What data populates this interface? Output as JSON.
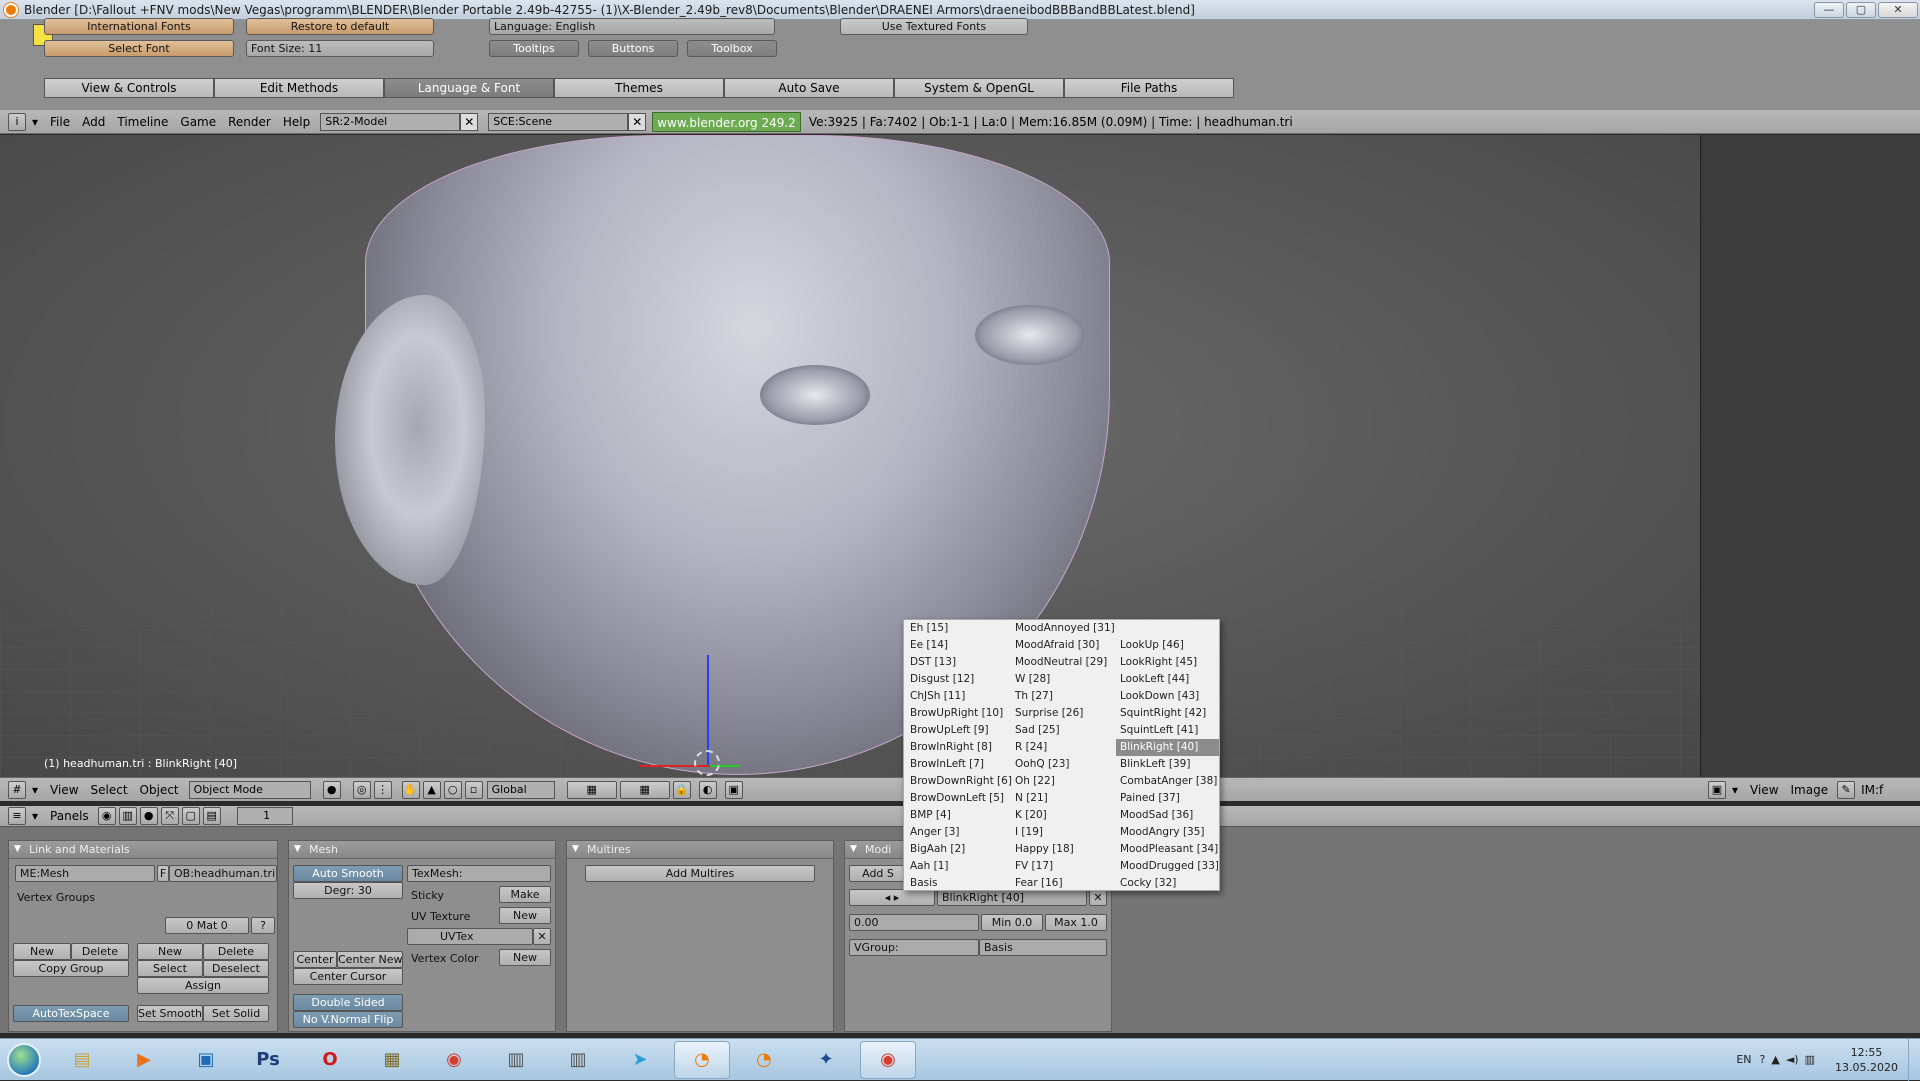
{
  "window": {
    "title": "Blender [D:\\Fallout +FNV mods\\New Vegas\\programm\\BLENDER\\Blender Portable 2.49b-42755- (1)\\X-Blender_2.49b_rev8\\Documents\\Blender\\DRAENEI Armors\\draeneibodBBBandBBLatest.blend]",
    "minimize": "—",
    "maximize": "▢",
    "close": "✕"
  },
  "prefs": {
    "international_fonts": "International Fonts",
    "select_font": "Select Font",
    "restore_default": "Restore to default",
    "font_size": "Font Size:  11",
    "language": "Language:  English",
    "use_textured_fonts": "Use Textured Fonts",
    "tooltips": "Tooltips",
    "buttons": "Buttons",
    "toolbox": "Toolbox",
    "tabs": [
      "View & Controls",
      "Edit Methods",
      "Language & Font",
      "Themes",
      "Auto Save",
      "System & OpenGL",
      "File Paths"
    ]
  },
  "menubar": {
    "items": [
      "File",
      "Add",
      "Timeline",
      "Game",
      "Render",
      "Help"
    ],
    "screen": "SR:2-Model",
    "scene": "SCE:Scene",
    "url": "www.blender.org 249.2",
    "stats": "Ve:3925 | Fa:7402 | Ob:1-1 | La:0  | Mem:16.85M (0.09M)  | Time:  | headhuman.tri"
  },
  "viewport": {
    "object_label": "(1) headhuman.tri : BlinkRight [40]"
  },
  "view3d_header": {
    "menus": [
      "View",
      "Select",
      "Object"
    ],
    "mode": "Object Mode",
    "orientation": "Global"
  },
  "image_header": {
    "menus": [
      "View",
      "Image"
    ],
    "im_field": "IM:f"
  },
  "buttons_header": {
    "panels": "Panels",
    "frame": "1"
  },
  "link_materials": {
    "title": "Link and Materials",
    "mesh": "ME:Mesh",
    "f": "F",
    "object": "OB:headhuman.tri",
    "vertex_groups": "Vertex Groups",
    "mat": "0 Mat 0",
    "q": "?",
    "new": "New",
    "delete": "Delete",
    "copy_group": "Copy Group",
    "new2": "New",
    "delete2": "Delete",
    "select": "Select",
    "deselect": "Deselect",
    "assign": "Assign",
    "autotexspace": "AutoTexSpace",
    "set_smooth": "Set Smooth",
    "set_solid": "Set Solid"
  },
  "mesh": {
    "title": "Mesh",
    "auto_smooth": "Auto Smooth",
    "degr": "Degr: 30",
    "texmesh": "TexMesh:",
    "sticky": "Sticky",
    "make": "Make",
    "uv_texture": "UV Texture",
    "new_uv": "New",
    "uvtex": "UVTex",
    "vertex_color": "Vertex Color",
    "new_vc": "New",
    "center": "Center",
    "center_new": "Center New",
    "center_cursor": "Center Cursor",
    "double_sided": "Double Sided",
    "no_vnormal_flip": "No V.Normal Flip"
  },
  "multires": {
    "title": "Multires",
    "add": "Add Multires"
  },
  "shapes": {
    "title": "Modi",
    "add": "Add S",
    "current": "BlinkRight [40]",
    "value": "0.00",
    "min": "Min 0.0",
    "max": "Max 1.0",
    "vgroup_label": "VGroup:",
    "vgroup": "Basis"
  },
  "shape_popup": {
    "col1": [
      "Eh [15]",
      "Ee [14]",
      "DST [13]",
      "Disgust [12]",
      "ChJSh [11]",
      "BrowUpRight [10]",
      "BrowUpLeft [9]",
      "BrowInRight [8]",
      "BrowInLeft [7]",
      "BrowDownRight [6]",
      "BrowDownLeft [5]",
      "BMP [4]",
      "Anger [3]",
      "BigAah [2]",
      "Aah [1]",
      "Basis"
    ],
    "col2": [
      "MoodAnnoyed [31]",
      "MoodAfraid [30]",
      "MoodNeutral [29]",
      "W [28]",
      "Th [27]",
      "Surprise [26]",
      "Sad [25]",
      "R [24]",
      "OohQ [23]",
      "Oh [22]",
      "N [21]",
      "K [20]",
      "I [19]",
      "Happy [18]",
      "FV [17]",
      "Fear [16]"
    ],
    "col3": [
      "",
      "LookUp [46]",
      "LookRight [45]",
      "LookLeft [44]",
      "LookDown [43]",
      "SquintRight [42]",
      "SquintLeft [41]",
      "BlinkRight [40]",
      "BlinkLeft [39]",
      "CombatAnger [38]",
      "Pained [37]",
      "MoodSad [36]",
      "MoodAngry [35]",
      "MoodPleasant [34]",
      "MoodDrugged [33]",
      "Cocky [32]"
    ],
    "highlighted": "BlinkRight [40]"
  },
  "taskbar": {
    "apps": [
      "Explorer",
      "Media",
      "Files",
      "Ps",
      "Opera",
      "Tool",
      "Chrome",
      "Film",
      "Film2",
      "Telegram",
      "Blender",
      "Blender2",
      "Tool3",
      "Chrome2"
    ],
    "lang": "EN",
    "time": "12:55",
    "date": "13.05.2020"
  }
}
